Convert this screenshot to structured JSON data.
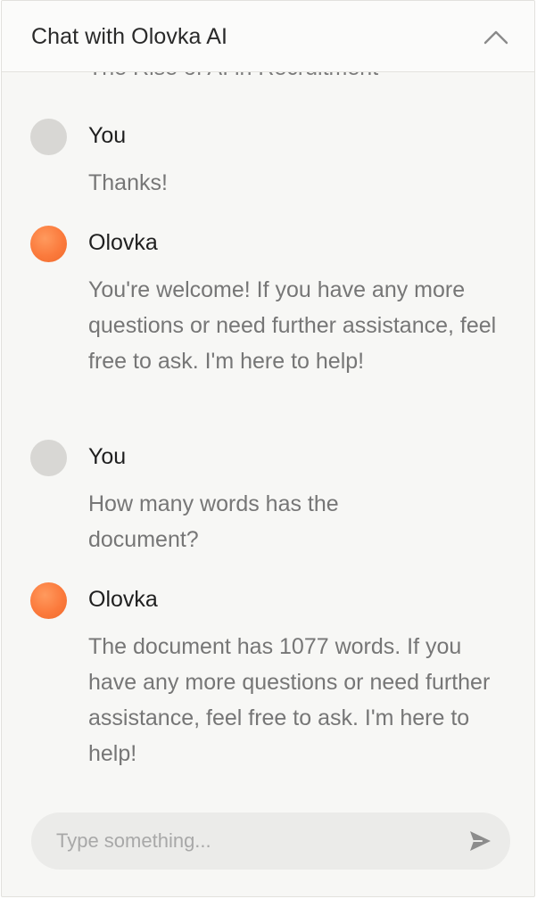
{
  "header": {
    "title": "Chat with Olovka AI",
    "collapse_icon": "chevron-up-icon"
  },
  "messages": {
    "cut_off_text": "The Rise of AI in Recruitment",
    "items": [
      {
        "author": "You",
        "role": "user",
        "text": "Thanks!"
      },
      {
        "author": "Olovka",
        "role": "bot",
        "text": "You're welcome! If you have any more questions or need further assistance, feel free to ask. I'm here to help!"
      },
      {
        "author": "You",
        "role": "user",
        "text": "How many words has the document?"
      },
      {
        "author": "Olovka",
        "role": "bot",
        "text": "The document has 1077 words. If you have any more questions or need further assistance, feel free to ask. I'm here to help!"
      }
    ]
  },
  "composer": {
    "placeholder": "Type something...",
    "value": "",
    "send_icon": "send-icon"
  },
  "colors": {
    "user_avatar": "#d8d7d4",
    "bot_avatar": "#fb7a3c",
    "panel_bg": "#f7f7f5",
    "input_bg": "#ebebe9"
  }
}
